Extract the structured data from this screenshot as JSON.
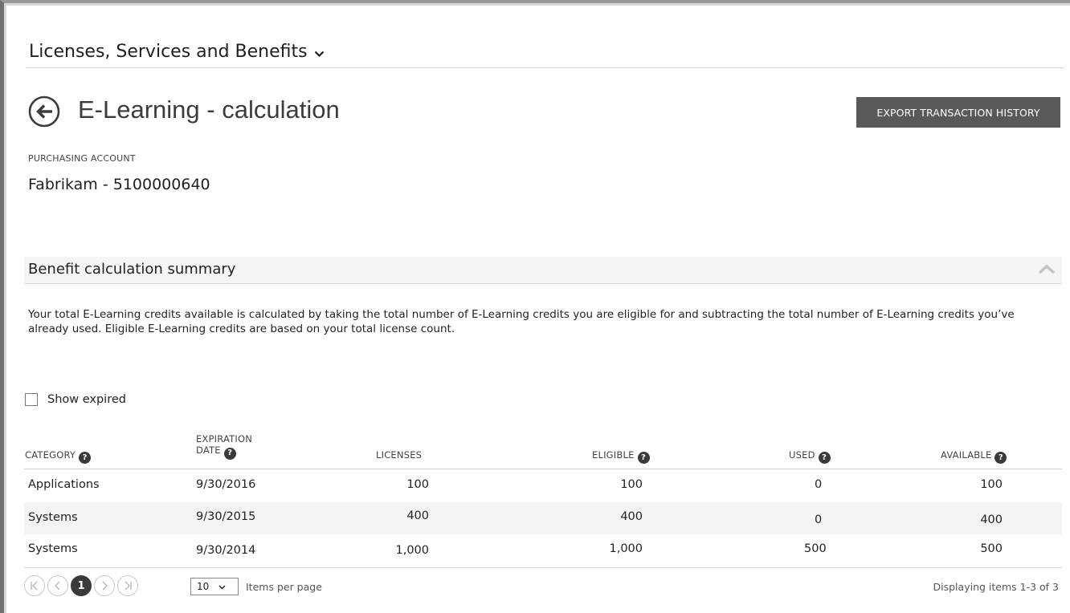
{
  "header": {
    "section_title": "Licenses, Services and Benefits",
    "section_chevron": "chevron-down-icon"
  },
  "page": {
    "title": "E-Learning - calculation",
    "back_icon": "back-arrow-icon",
    "export_label": "EXPORT TRANSACTION HISTORY"
  },
  "account": {
    "label": "PURCHASING ACCOUNT",
    "value": "Fabrikam - 5100000640"
  },
  "summary": {
    "title": "Benefit calculation summary",
    "collapse_icon": "chevron-up-icon",
    "description": "Your total E-Learning credits available is calculated by taking the total number of E-Learning credits you are eligible for and subtracting the total number of E-Learning credits you’ve already used. Eligible E-Learning credits are based on your total license count."
  },
  "filter": {
    "show_expired_label": "Show expired",
    "show_expired_checked": false
  },
  "table": {
    "headers": {
      "category": "CATEGORY",
      "expiration_line1": "EXPIRATION",
      "expiration_line2": "DATE",
      "licenses": "LICENSES",
      "eligible": "ELIGIBLE",
      "used": "USED",
      "available": "AVAILABLE"
    },
    "help_glyph": "?",
    "rows": [
      {
        "category": "Applications",
        "expiration": "9/30/2016",
        "licenses": "100",
        "eligible": "100",
        "used": "0",
        "available": "100"
      },
      {
        "category": "Systems",
        "expiration": "9/30/2015",
        "licenses": "400",
        "eligible": "400",
        "used": "0",
        "available": "400"
      },
      {
        "category": "Systems",
        "expiration": "9/30/2014",
        "licenses": "1,000",
        "eligible": "1,000",
        "used": "500",
        "available": "500"
      }
    ]
  },
  "pagination": {
    "current_page": "1",
    "page_size": "10",
    "items_per_page_label": "Items per page",
    "display_text": "Displaying items 1-3 of 3"
  },
  "colors": {
    "button_bg": "#595959",
    "alt_row_bg": "#f4f4f4",
    "summary_bar_bg": "#f5f5f5"
  }
}
